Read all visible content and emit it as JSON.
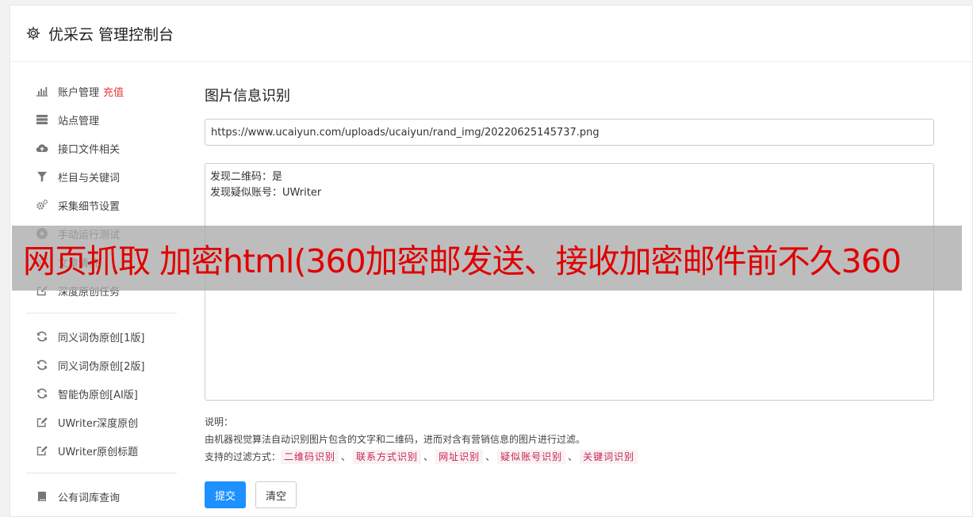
{
  "header": {
    "title": "优采云 管理控制台",
    "icon": "gear-icon"
  },
  "sidebar": {
    "group1": [
      {
        "label": "账户管理",
        "badge": "充值",
        "icon": "bar-chart-icon"
      },
      {
        "label": "站点管理",
        "icon": "server-icon"
      },
      {
        "label": "接口文件相关",
        "icon": "cloud-upload-icon"
      },
      {
        "label": "栏目与关键词",
        "icon": "filter-icon"
      },
      {
        "label": "采集细节设置",
        "icon": "gears-icon"
      },
      {
        "label": "手动运行测试",
        "icon": "play-icon"
      },
      {
        "label": "文章清洗",
        "icon": "gears-icon"
      },
      {
        "label": "深度原创任务",
        "icon": "edit-icon"
      }
    ],
    "group2": [
      {
        "label": "同义词伪原创[1版]",
        "icon": "refresh-icon"
      },
      {
        "label": "同义词伪原创[2版]",
        "icon": "refresh-icon"
      },
      {
        "label": "智能伪原创[AI版]",
        "icon": "refresh-icon"
      },
      {
        "label": "UWriter深度原创",
        "icon": "edit-icon"
      },
      {
        "label": "UWriter原创标题",
        "icon": "edit-icon"
      }
    ],
    "group3": [
      {
        "label": "公有词库查询",
        "icon": "book-icon"
      }
    ]
  },
  "main": {
    "title": "图片信息识别",
    "url_value": "https://www.ucaiyun.com/uploads/ucaiyun/rand_img/20220625145737.png",
    "result_text": "发现二维码：是\n发现疑似账号：UWriter",
    "note_title": "说明：",
    "note_desc": "由机器视觉算法自动识别图片包含的文字和二维码，进而对含有营销信息的图片进行过滤。",
    "filter_label": "支持的过滤方式：",
    "filters": [
      "二维码识别",
      "联系方式识别",
      "网址识别",
      "疑似账号识别",
      "关键词识别"
    ],
    "filter_sep": "、",
    "submit_label": "提交",
    "clear_label": "清空"
  },
  "overlay": {
    "text": "网页抓取 加密html(360加密邮发送、接收加密邮件前不久360"
  },
  "colors": {
    "primary": "#1e90ff",
    "badge": "#e4393c",
    "tag_text": "#c7254e",
    "tag_bg": "#f9f2f4",
    "overlay_text": "#e00000"
  }
}
